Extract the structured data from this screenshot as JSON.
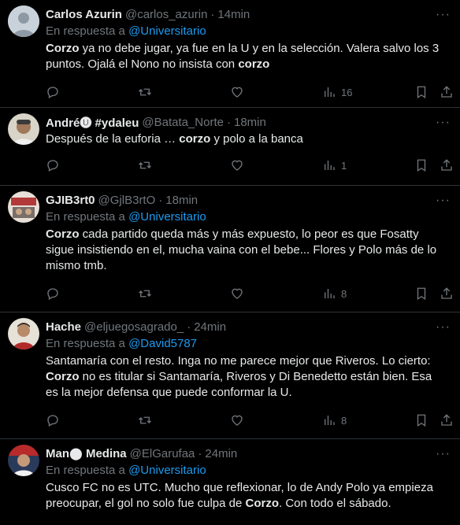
{
  "tweets": [
    {
      "name": "Carlos Azurin",
      "handle": "@carlos_azurin",
      "time": "14min",
      "reply_prefix": "En respuesta a",
      "reply_to": "@Universitario",
      "text_html": "<b>Corzo</b> ya no debe jugar, ya fue en la U y en la selección. Valera salvo los 3 puntos. Ojalá el Nono no insista con <b>corzo</b>",
      "views": "16",
      "avatar": "default-avatar"
    },
    {
      "name": "André🅤 #ydaleu",
      "handle": "@Batata_Norte",
      "time": "18min",
      "reply_prefix": "",
      "reply_to": "",
      "text_html": "Después de la euforia … <b>corzo</b> y polo a la banca",
      "views": "1",
      "avatar": "photo-avatar"
    },
    {
      "name": "GJIB3rt0",
      "handle": "@GjlB3rtO",
      "time": "18min",
      "reply_prefix": "En respuesta a",
      "reply_to": "@Universitario",
      "text_html": "<b>Corzo</b> cada partido queda  más y más expuesto, lo peor es que Fosatty sigue insistiendo en el, mucha vaina con el bebe... Flores y Polo más de lo mismo tmb.",
      "views": "8",
      "avatar": "photo-avatar"
    },
    {
      "name": "Hache",
      "handle": "@eljuegosagrado_",
      "time": "24min",
      "reply_prefix": "En respuesta a",
      "reply_to": "@David5787",
      "text_html": "Santamaría con el resto. Inga no me parece mejor que Riveros. Lo cierto: <b>Corzo</b> no es titular si Santamaría, Riveros y Di Benedetto están bien. Esa es la mejor defensa que puede conformar la U.",
      "views": "8",
      "avatar": "photo-avatar"
    },
    {
      "name": "Man⬤ Medina",
      "handle": "@ElGarufaa",
      "time": "24min",
      "reply_prefix": "En respuesta a",
      "reply_to": "@Universitario",
      "text_html": "Cusco FC no es UTC. Mucho que reflexionar,  lo de Andy Polo ya empieza preocupar, el gol no solo fue culpa de <b>Corzo</b>. Con todo el sábado.",
      "views": "",
      "avatar": "photo-avatar"
    }
  ],
  "icons": {
    "reply": "reply-icon",
    "retweet": "retweet-icon",
    "like": "like-icon",
    "views": "views-icon",
    "bookmark": "bookmark-icon",
    "share": "share-icon",
    "more": "more-icon"
  },
  "colors": {
    "background": "#000000",
    "text": "#e7e9ea",
    "secondary": "#71767b",
    "link": "#1d9bf0",
    "divider": "#2f3336"
  }
}
